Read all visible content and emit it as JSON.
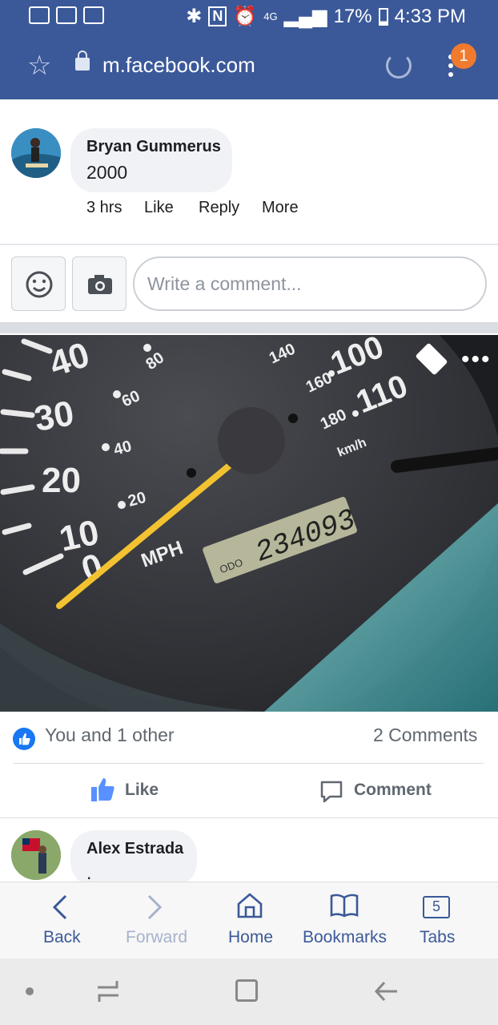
{
  "status_bar": {
    "battery": "17%",
    "time": "4:33 PM",
    "network": "4G",
    "icons": [
      "activity-icon",
      "voicemail-icon",
      "car-icon",
      "bluetooth-icon",
      "nfc-icon",
      "alarm-icon",
      "signal-icon",
      "battery-icon"
    ]
  },
  "browser": {
    "url": "m.facebook.com",
    "notification_count": "1"
  },
  "comment_top": {
    "name": "Bryan Gummerus",
    "text": "2000",
    "time": "3 hrs",
    "actions": [
      "Like",
      "Reply",
      "More"
    ]
  },
  "composer": {
    "placeholder": "Write a comment..."
  },
  "photo": {
    "odometer": "234093",
    "dial_left": [
      "40",
      "30",
      "20",
      "10",
      "0"
    ],
    "dial_inner": [
      "80",
      "60",
      "40",
      "20"
    ],
    "dial_right": [
      "140",
      "160",
      "100",
      "180",
      "110"
    ],
    "mph_label": "MPH",
    "kmh_label": "km/h",
    "odo_label": "ODO"
  },
  "reactions": {
    "summary": "You and 1 other",
    "comments": "2 Comments"
  },
  "post_actions": {
    "like": "Like",
    "comment": "Comment"
  },
  "comment_bottom": {
    "name": "Alex Estrada",
    "text": "."
  },
  "bottom_nav": {
    "back": "Back",
    "forward": "Forward",
    "home": "Home",
    "bookmarks": "Bookmarks",
    "tabs": "Tabs",
    "tab_count": "5"
  },
  "colors": {
    "facebook_blue": "#3b5999",
    "like_blue": "#1877f2",
    "badge_orange": "#f07a2d",
    "needle": "#f2c230"
  }
}
